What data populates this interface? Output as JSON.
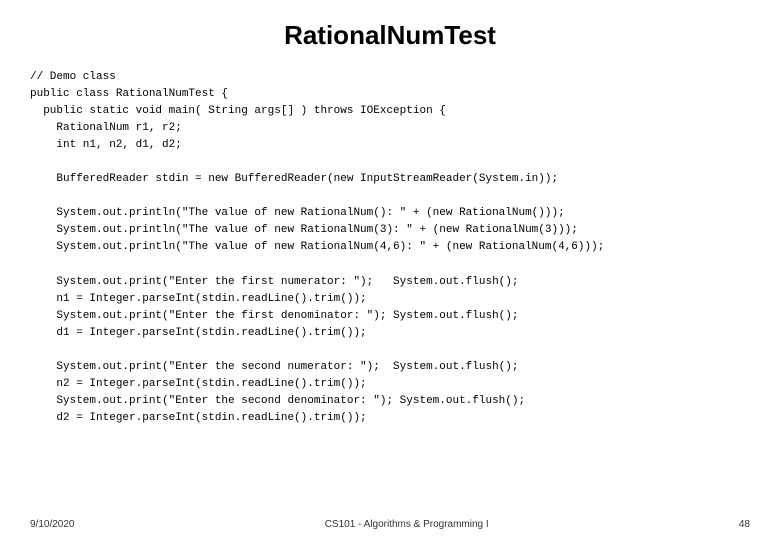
{
  "title": "RationalNumTest",
  "code": {
    "lines": [
      "// Demo class",
      "public class RationalNumTest {",
      "  public static void main( String args[] ) throws IOException {",
      "    RationalNum r1, r2;",
      "    int n1, n2, d1, d2;",
      "",
      "    BufferedReader stdin = new BufferedReader(new InputStreamReader(System.in));",
      "",
      "    System.out.println(\"The value of new RationalNum(): \" + (new RationalNum()));",
      "    System.out.println(\"The value of new RationalNum(3): \" + (new RationalNum(3)));",
      "    System.out.println(\"The value of new RationalNum(4,6): \" + (new RationalNum(4,6)));",
      "",
      "    System.out.print(\"Enter the first numerator: \");   System.out.flush();",
      "    n1 = Integer.parseInt(stdin.readLine().trim());",
      "    System.out.print(\"Enter the first denominator: \"); System.out.flush();",
      "    d1 = Integer.parseInt(stdin.readLine().trim());",
      "",
      "    System.out.print(\"Enter the second numerator: \");  System.out.flush();",
      "    n2 = Integer.parseInt(stdin.readLine().trim());",
      "    System.out.print(\"Enter the second denominator: \"); System.out.flush();",
      "    d2 = Integer.parseInt(stdin.readLine().trim());"
    ]
  },
  "footer": {
    "left": "9/10/2020",
    "center": "CS101 - Algorithms & Programming I",
    "right": "48"
  }
}
